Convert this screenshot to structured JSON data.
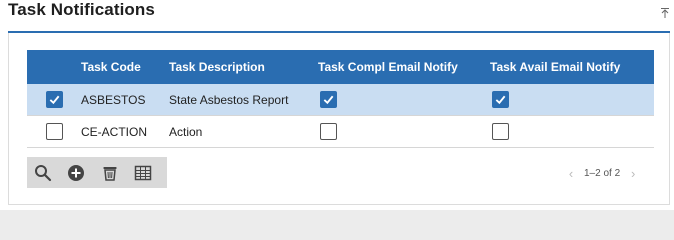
{
  "panel": {
    "title": "Task Notifications",
    "collapse_icon": "collapse-up-icon"
  },
  "grid": {
    "columns": [
      "",
      "Task Code",
      "Task Description",
      "Task Compl Email Notify",
      "Task Avail Email Notify"
    ],
    "rows": [
      {
        "selected": true,
        "code": "ASBESTOS",
        "description": "State Asbestos Report",
        "compl_notify": true,
        "avail_notify": true
      },
      {
        "selected": false,
        "code": "CE-ACTION",
        "description": "Action",
        "compl_notify": false,
        "avail_notify": false
      }
    ]
  },
  "toolbar": {
    "buttons": [
      "search-icon",
      "add-icon",
      "delete-icon",
      "columns-icon"
    ]
  },
  "pager": {
    "range": "1–2 of 2",
    "prev_icon": "chevron-left-icon",
    "next_icon": "chevron-right-icon"
  },
  "colors": {
    "accent": "#2a6db1",
    "selected_row": "#c9ddf2",
    "toolbar_bg": "#d9d9d9"
  }
}
